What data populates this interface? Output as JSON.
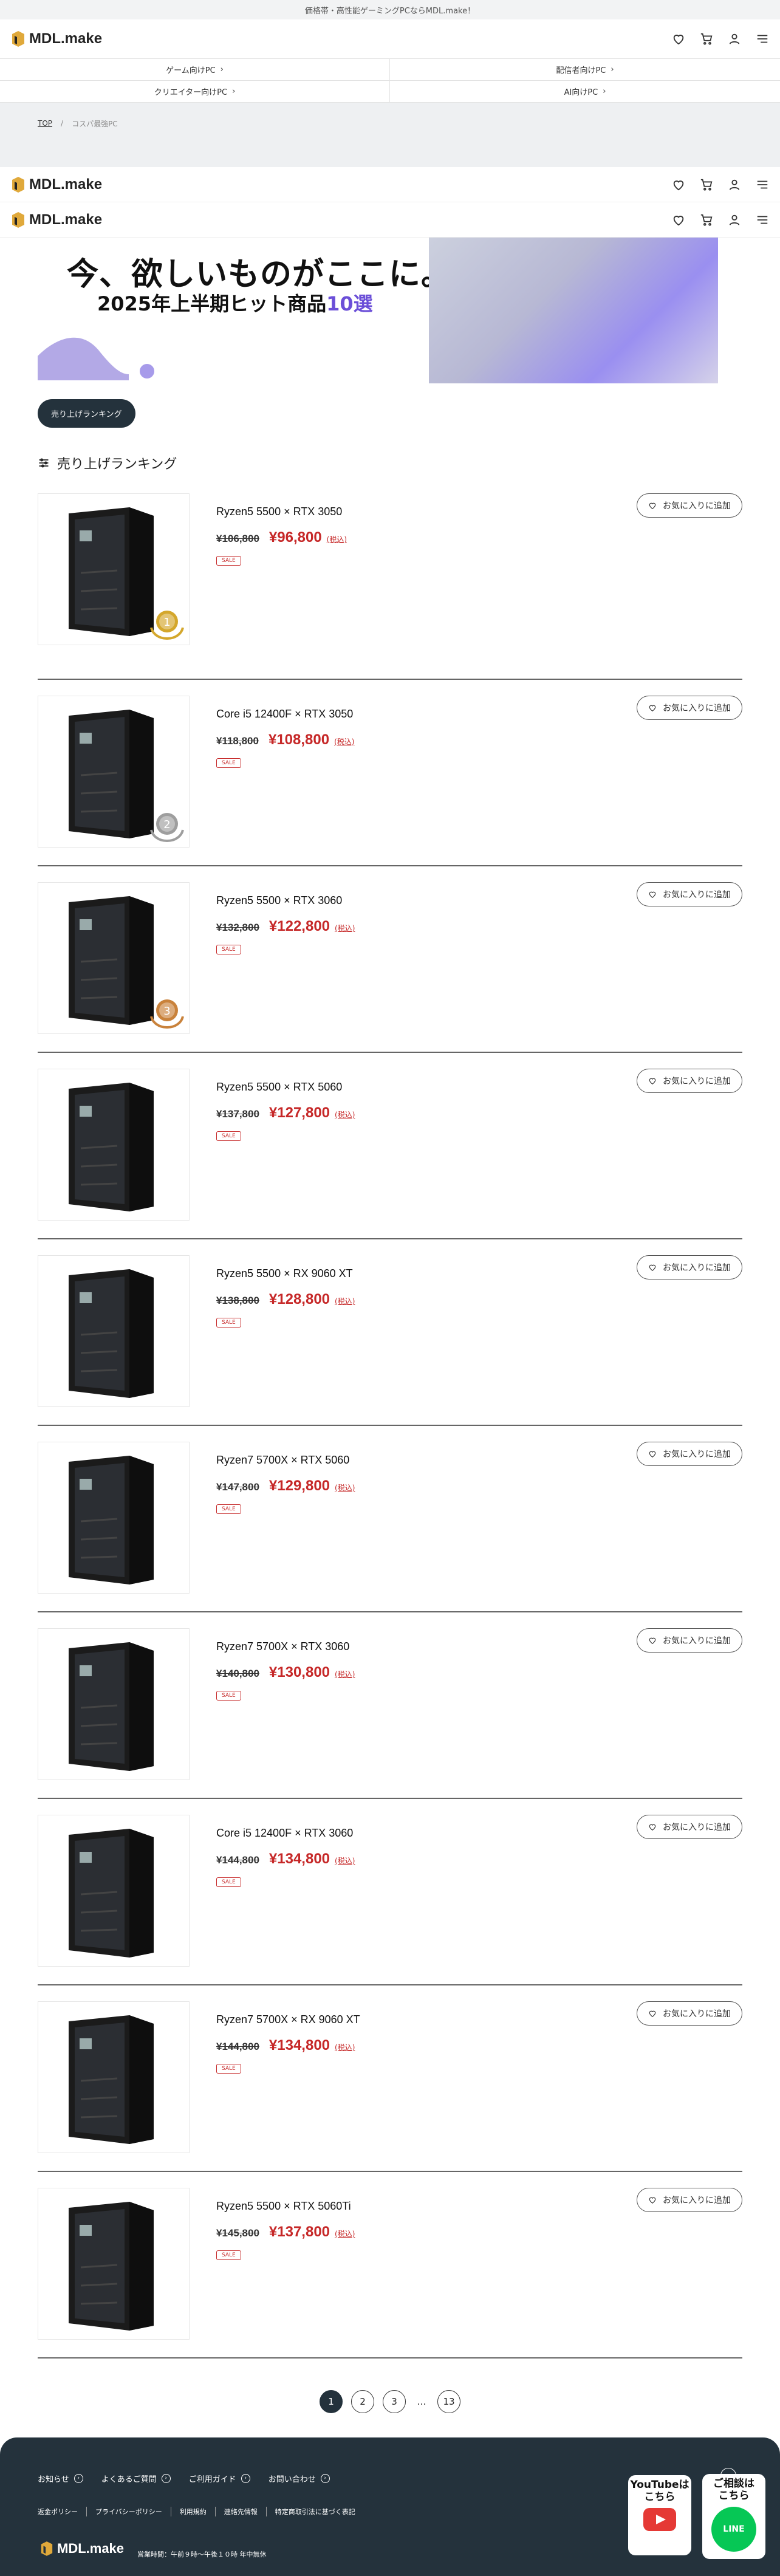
{
  "topbar": {
    "text": "価格帯・高性能ゲーミングPCならMDL.make！"
  },
  "header": {
    "logo": "MDL.make"
  },
  "catnav": {
    "items": [
      "ゲーム向けPC",
      "配信者向けPC",
      "クリエイター向けPC",
      "AI向けPC"
    ]
  },
  "breadcrumb": {
    "top": "TOP",
    "current": "コスパ最強PC"
  },
  "hero": {
    "title": "今、欲しいものがここに。",
    "subtitle": "2025年上半期ヒット商品",
    "highlight": "10選"
  },
  "ranking_button": "売り上げランキング",
  "section_title": "売り上げランキング",
  "fav_label": "お気に入りに追加",
  "tax_label": "(税込)",
  "sale_label": "SALE",
  "products": [
    {
      "name": "Ryzen5 5500 × RTX 3050",
      "old": "¥106,800",
      "price": "¥96,800",
      "rank": "1"
    },
    {
      "name": "Core i5 12400F × RTX 3050",
      "old": "¥118,800",
      "price": "¥108,800",
      "rank": "2"
    },
    {
      "name": "Ryzen5 5500 × RTX 3060",
      "old": "¥132,800",
      "price": "¥122,800",
      "rank": "3"
    },
    {
      "name": "Ryzen5 5500 × RTX 5060",
      "old": "¥137,800",
      "price": "¥127,800",
      "rank": ""
    },
    {
      "name": "Ryzen5 5500 × RX 9060 XT",
      "old": "¥138,800",
      "price": "¥128,800",
      "rank": ""
    },
    {
      "name": "Ryzen7 5700X × RTX 5060",
      "old": "¥147,800",
      "price": "¥129,800",
      "rank": ""
    },
    {
      "name": "Ryzen7 5700X × RTX 3060",
      "old": "¥140,800",
      "price": "¥130,800",
      "rank": ""
    },
    {
      "name": "Core i5 12400F × RTX 3060",
      "old": "¥144,800",
      "price": "¥134,800",
      "rank": ""
    },
    {
      "name": "Ryzen7 5700X × RX 9060 XT",
      "old": "¥144,800",
      "price": "¥134,800",
      "rank": ""
    },
    {
      "name": "Ryzen5 5500 × RTX 5060Ti",
      "old": "¥145,800",
      "price": "¥137,800",
      "rank": ""
    }
  ],
  "pager": {
    "pages": [
      "1",
      "2",
      "3",
      "…",
      "13"
    ]
  },
  "footer": {
    "links": [
      "お知らせ",
      "よくあるご質問",
      "ご利用ガイド",
      "お問い合わせ"
    ],
    "sublinks": [
      "返金ポリシー",
      "プライバシーポリシー",
      "利用規約",
      "連絡先情報",
      "特定商取引法に基づく表記"
    ],
    "logo": "MDL.make",
    "hours": "営業時間：午前９時〜午後１０時 年中無休",
    "youtube": [
      "YouTubeは",
      "こちら"
    ],
    "line": [
      "ご相談は",
      "こちら"
    ],
    "line_badge": "LINE"
  }
}
